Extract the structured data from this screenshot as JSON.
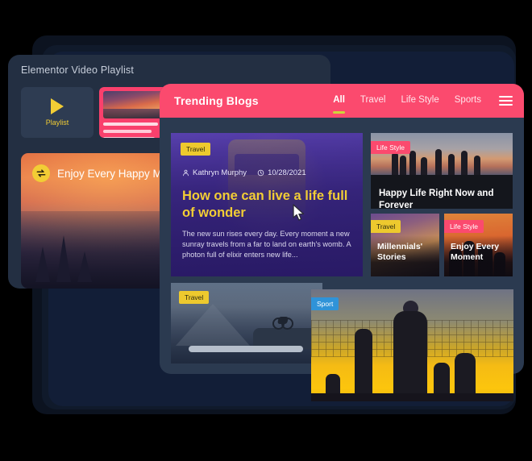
{
  "video_playlist": {
    "window_title": "Elementor Video Playlist",
    "playlist_tile": {
      "label": "Playlist",
      "icon": "play-icon"
    },
    "featured": {
      "title": "Enjoy Every Happy Moment",
      "icon": "exchange-circle-icon"
    }
  },
  "trending_blogs": {
    "brand": "Trending Blogs",
    "menu_icon": "hamburger-menu-icon",
    "nav": [
      {
        "label": "All",
        "active": true
      },
      {
        "label": "Travel",
        "active": false
      },
      {
        "label": "Life Style",
        "active": false
      },
      {
        "label": "Sports",
        "active": false
      }
    ],
    "colors": {
      "header": "#fb4a6e",
      "panel": "#2b3a50",
      "accent_underline": "#cdd63a",
      "badge_travel": "#edc92e",
      "badge_life": "#fb4a6e",
      "badge_sport": "#2f93d8",
      "title_yellow": "#f2cd35"
    },
    "featured_post": {
      "category": "Travel",
      "author": "Kathryn Murphy",
      "author_icon": "person-icon",
      "date": "10/28/2021",
      "date_icon": "clock-icon",
      "title": "How one can live a life full of wonder",
      "excerpt": "The new sun rises every day. Every moment a new sunray travels from a far to land on earth's womb. A photon full of elixir enters new life..."
    },
    "posts": [
      {
        "category": "Life Style",
        "title": "Happy Life Right Now and Forever"
      },
      {
        "category": "Travel",
        "title": "Millennials' Stories"
      },
      {
        "category": "Life Style",
        "title": "Enjoy Every Moment"
      },
      {
        "category": "Travel",
        "title": ""
      },
      {
        "category": "Sport",
        "title": ""
      }
    ]
  }
}
